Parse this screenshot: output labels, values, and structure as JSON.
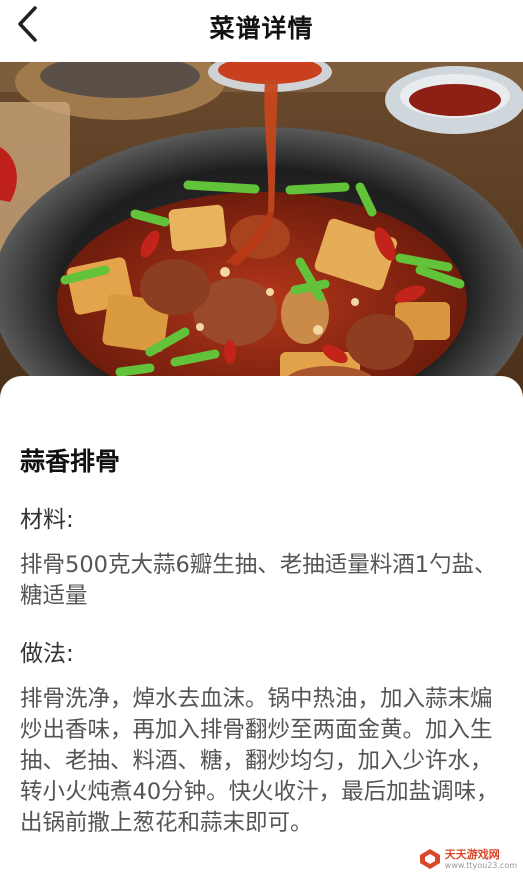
{
  "header": {
    "title": "菜谱详情",
    "back_icon": "chevron-left-icon"
  },
  "recipe": {
    "name": "蒜香排骨",
    "ingredients_label": "材料:",
    "ingredients": "排骨500克大蒜6瓣生抽、老抽适量料酒1勺盐、糖适量",
    "method_label": "做法:",
    "method": "排骨洗净，焯水去血沫。锅中热油，加入蒜末煸炒出香味，再加入排骨翻炒至两面金黄。加入生抽、老抽、料酒、糖，翻炒均匀，加入少许水，转小火炖煮40分钟。快火收汁，最后加盐调味，出锅前撒上葱花和蒜末即可。"
  },
  "watermark": {
    "name": "天天游戏网",
    "url": "www.ttyou23.com",
    "icon": "game-logo-icon"
  },
  "colors": {
    "background": "#ffffff",
    "title_text": "#111111",
    "body_text": "#555555",
    "watermark": "#d8482a"
  }
}
